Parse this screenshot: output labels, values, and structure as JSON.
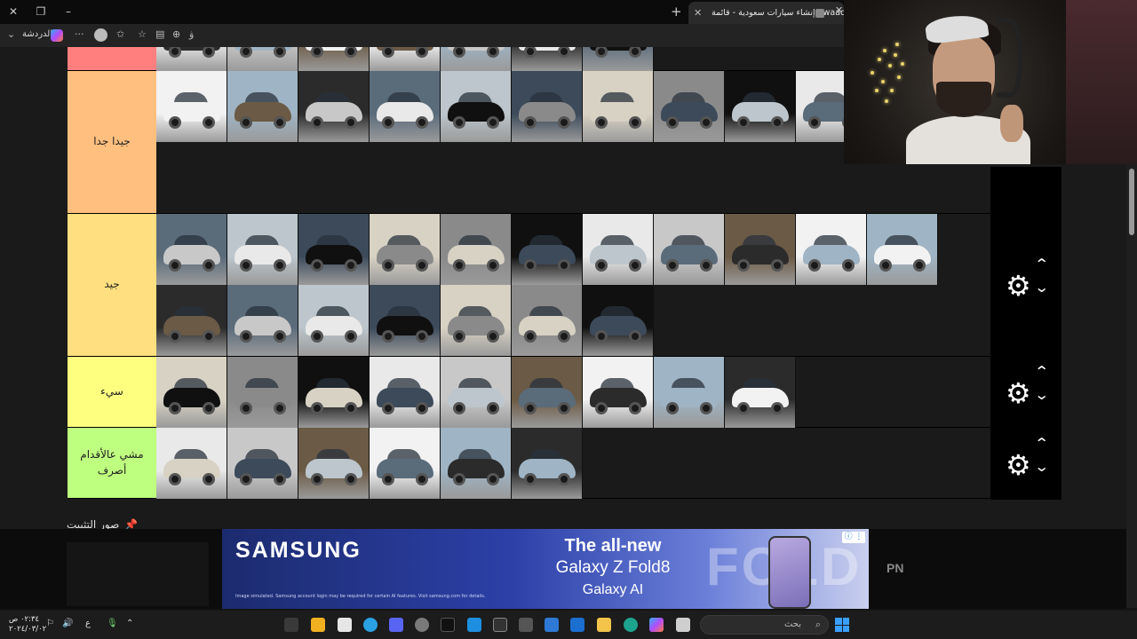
{
  "browser": {
    "tab_title": "إنشاء سيارات سعودية - قائمة Swaad",
    "chat_label": "الدردشة",
    "reader_icon": "ۋ"
  },
  "tiers": [
    {
      "label": "",
      "color": "#ff7f7f",
      "car_count": 7
    },
    {
      "label": "جيدا جدا",
      "color": "#ffbf7f",
      "car_count": 11
    },
    {
      "label": "جيد",
      "color": "#ffdf7f",
      "car_count": 18
    },
    {
      "label": "سيء",
      "color": "#ffff7f",
      "car_count": 9
    },
    {
      "label": "مشي عالأقدام أصرف",
      "color": "#bfff7f",
      "car_count": 6
    }
  ],
  "pinned_label": "صور التثبيت",
  "ad": {
    "brand": "SAMSUNG",
    "headline": "The all-new",
    "product": "Galaxy Z Fold8",
    "subline": "Galaxy AI",
    "watermark": "FOLD",
    "fineprint": "Image simulated. Samsung account login may be required for certain AI features. Visit samsung.com for details.",
    "side_text": "PN"
  },
  "taskbar": {
    "search_placeholder": "بحث",
    "time": "٠٢:٣٤ ص",
    "date": "٢٠٢٤/٠٣/٠٢",
    "lang": "ع"
  },
  "colors": {
    "car_palette": [
      "#e9e9e9",
      "#2b2b2b",
      "#8a8a8a",
      "#f2f2f2",
      "#3c4a5a",
      "#c8c8c8",
      "#5a6b7a",
      "#101010",
      "#9fb4c4",
      "#d8d2c4",
      "#6b5a45",
      "#bcc6cc"
    ]
  }
}
